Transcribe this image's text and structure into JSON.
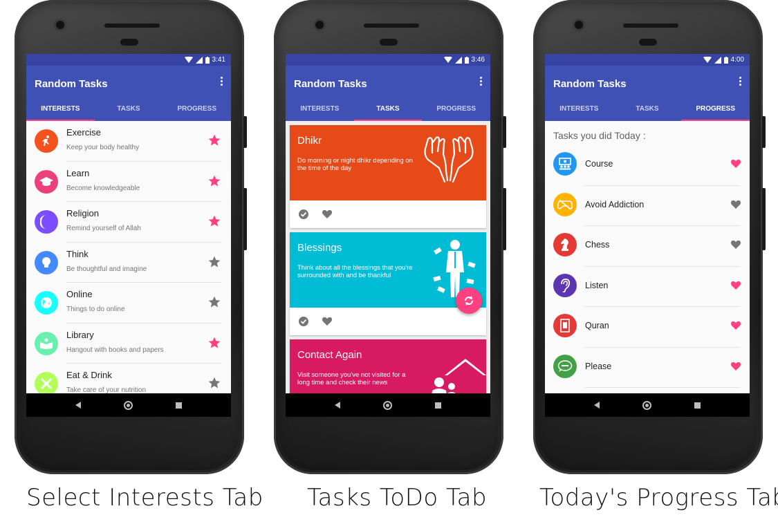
{
  "app": {
    "title": "Random Tasks"
  },
  "tabs": [
    "INTERESTS",
    "TASKS",
    "PROGRESS"
  ],
  "phones": [
    {
      "time": "3:41",
      "active_tab": "INTERESTS",
      "caption": "Select Interests Tab"
    },
    {
      "time": "3:46",
      "active_tab": "TASKS",
      "caption": "Tasks ToDo Tab"
    },
    {
      "time": "4:00",
      "active_tab": "PROGRESS",
      "caption": "Today's Progress Tab"
    }
  ],
  "interests": [
    {
      "name": "Exercise",
      "desc": "Keep your body healthy",
      "color": "#f4511e",
      "icon": "runner-icon",
      "starred": true
    },
    {
      "name": "Learn",
      "desc": "Become knowledgeable",
      "color": "#ec407a",
      "icon": "graduation-cap-icon",
      "starred": true
    },
    {
      "name": "Religion",
      "desc": "Remind yourself of Allah",
      "color": "#7c4dff",
      "icon": "crescent-moon-icon",
      "starred": true
    },
    {
      "name": "Think",
      "desc": "Be thoughtful and imagine",
      "color": "#448aff",
      "icon": "lightbulb-icon",
      "starred": false
    },
    {
      "name": "Online",
      "desc": "Things to do online",
      "color": "#18ffff",
      "icon": "globe-icon",
      "starred": false
    },
    {
      "name": "Library",
      "desc": "Hangout with books and papers",
      "color": "#69f0ae",
      "icon": "book-icon",
      "starred": true
    },
    {
      "name": "Eat & Drink",
      "desc": "Take care of your nutrition",
      "color": "#b2ff59",
      "icon": "fork-knife-icon",
      "starred": false
    }
  ],
  "tasks": [
    {
      "title": "Dhikr",
      "desc": "Do morning or night dhikr depending on the time of the day",
      "color": "#e64a19",
      "art": "praying-hands-icon"
    },
    {
      "title": "Blessings",
      "desc": "Think about all the blessings that you're surrounded with and be thankful",
      "color": "#00bcd4",
      "art": "man-with-money-icon"
    },
    {
      "title": "Contact Again",
      "desc": "Visit someone you've not visited for a long time and check their news",
      "color": "#d81b60",
      "art": "family-house-icon"
    }
  ],
  "progress": {
    "heading": "Tasks you did Today :",
    "items": [
      {
        "name": "Course",
        "color": "#2196f3",
        "icon": "classroom-icon",
        "loved": true
      },
      {
        "name": "Avoid Addiction",
        "color": "#ffb300",
        "icon": "gamepad-icon",
        "loved": false
      },
      {
        "name": "Chess",
        "color": "#e53935",
        "icon": "chess-knight-icon",
        "loved": false
      },
      {
        "name": "Listen",
        "color": "#5e35b1",
        "icon": "ear-icon",
        "loved": true
      },
      {
        "name": "Quran",
        "color": "#e53935",
        "icon": "quran-book-icon",
        "loved": true
      },
      {
        "name": "Please",
        "color": "#43a047",
        "icon": "speech-bubble-icon",
        "loved": true
      }
    ]
  },
  "colors": {
    "primary": "#3f51b5",
    "primary_dark": "#3844a3",
    "accent": "#ff4081",
    "inactive_icon": "#757575"
  }
}
